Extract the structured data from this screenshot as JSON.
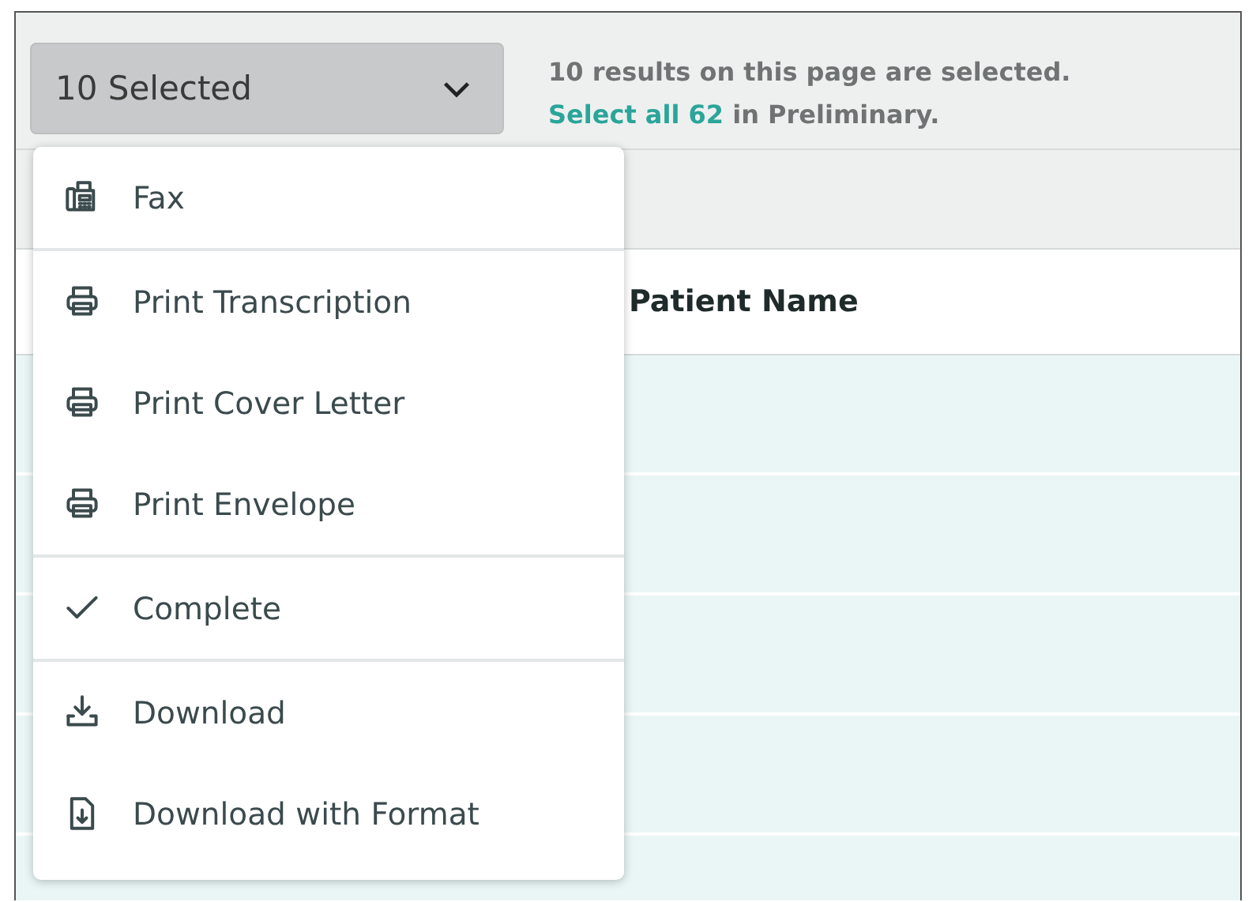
{
  "selection_dropdown": {
    "label": "10 Selected",
    "expanded": true
  },
  "selection_message": {
    "text": "10 results on this page are selected.",
    "link": "Select all 62",
    "rest": " in Preliminary."
  },
  "table": {
    "columns": [
      "Patient Name"
    ]
  },
  "menu": {
    "groups": [
      [
        {
          "label": "Fax",
          "kind": "fax"
        }
      ],
      [
        {
          "label": "Print Transcription",
          "kind": "print"
        },
        {
          "label": "Print Cover Letter",
          "kind": "print"
        },
        {
          "label": "Print Envelope",
          "kind": "print"
        }
      ],
      [
        {
          "label": "Complete",
          "kind": "complete"
        }
      ],
      [
        {
          "label": "Download",
          "kind": "download"
        },
        {
          "label": "Download with Format",
          "kind": "formatted"
        }
      ]
    ]
  }
}
